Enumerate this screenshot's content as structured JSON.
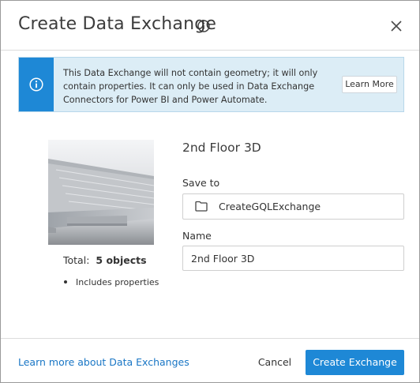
{
  "dialog": {
    "title": "Create Data Exchange",
    "info_icon": "info-circle-icon",
    "close_icon": "close-icon"
  },
  "banner": {
    "icon": "info-circle-icon",
    "message": "This Data Exchange will not contain geometry; it will only contain properties. It can only be used in Data Exchange Connectors for Power BI and Power Automate.",
    "learn_more_label": "Learn More",
    "accent_color": "#1e88d6",
    "background_color": "#dcedf6"
  },
  "preview": {
    "total_label": "Total:",
    "total_value": "5 objects",
    "bullets": [
      "Includes properties"
    ]
  },
  "form": {
    "exchange_name": "2nd Floor 3D",
    "save_to_label": "Save to",
    "save_to_icon": "folder-icon",
    "save_to_value": "CreateGQLExchange",
    "name_label": "Name",
    "name_value": "2nd Floor 3D"
  },
  "footer": {
    "learn_link": "Learn more about Data Exchanges",
    "cancel_label": "Cancel",
    "create_label": "Create Exchange",
    "primary_color": "#1e88d6",
    "link_color": "#1976c5"
  }
}
